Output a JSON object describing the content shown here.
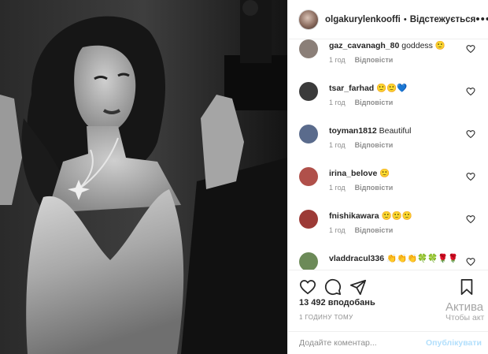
{
  "post": {
    "username": "olgakurylenkooffi",
    "separator": "•",
    "follow_status": "Відстежується",
    "more_icon": "more-horizontal-icon",
    "likes": "13 492 вподобань",
    "time": "1 ГОДИНУ ТОМУ"
  },
  "comments": [
    {
      "username": "gaz_cavanagh_80",
      "text": "goddess 🙂",
      "time": "1 год",
      "reply": "Відповісти",
      "avatar_color": "#8b7f78"
    },
    {
      "username": "tsar_farhad",
      "text": "🙂🙂💙",
      "time": "1 год",
      "reply": "Відповісти",
      "avatar_color": "#3b3b3b"
    },
    {
      "username": "toyman1812",
      "text": "Beautiful",
      "time": "1 год",
      "reply": "Відповісти",
      "avatar_color": "#5a6b8c"
    },
    {
      "username": "irina_belove",
      "text": "🙂",
      "time": "1 год",
      "reply": "Відповісти",
      "avatar_color": "#b0504a"
    },
    {
      "username": "fnishikawara",
      "text": "🙂🙂🙂",
      "time": "1 год",
      "reply": "Відповісти",
      "avatar_color": "#9c3a36"
    },
    {
      "username": "vladdracul336",
      "text": "👏👏👏🍀🍀🌹🌹",
      "time": "",
      "reply": "",
      "avatar_color": "#6c8a58"
    }
  ],
  "add_comment": {
    "placeholder": "Додайте коментар...",
    "post_label": "Опублікувати"
  },
  "watermark": {
    "line1": "Актива",
    "line2": "Чтобы акт"
  },
  "colors": {
    "accent_blue_disabled": "#b2dffc",
    "muted_text": "#8e8e8e",
    "border": "#efefef"
  }
}
